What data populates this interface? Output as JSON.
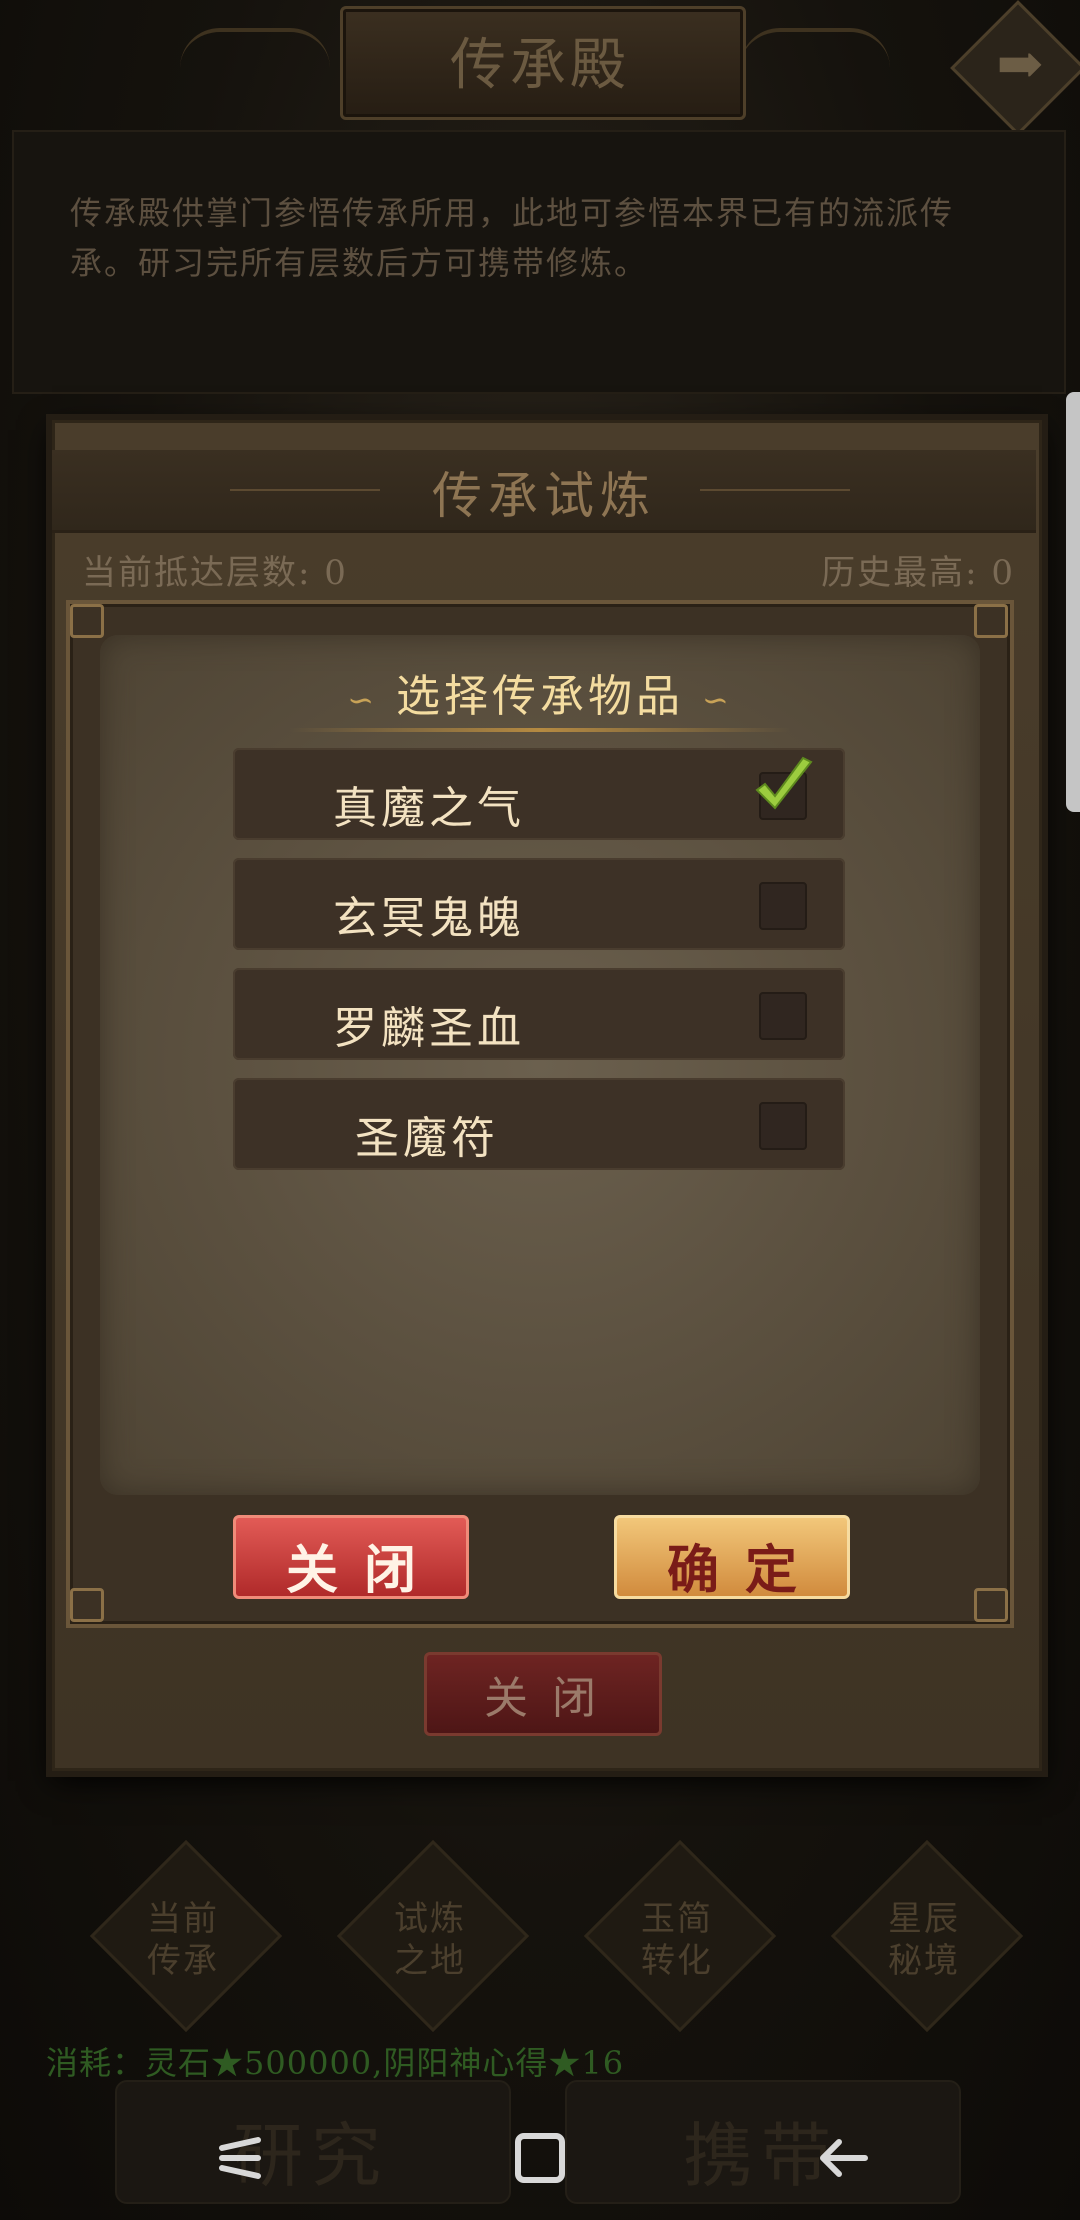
{
  "header": {
    "title": "传承殿",
    "description": "传承殿供掌门参悟传承所用，此地可参悟本界已有的流派传承。研习完所有层数后方可携带修炼。",
    "arrow_glyph": "➡"
  },
  "trial": {
    "title": "传承试炼",
    "current_floor_label": "当前抵达层数: 0",
    "history_high_label": "历史最高: 0",
    "close_label": "关闭"
  },
  "modal": {
    "title": "选择传承物品",
    "title_ornament_left": "∽",
    "title_ornament_right": "∽",
    "items": [
      {
        "label": "真魔之气",
        "checked": true
      },
      {
        "label": "玄冥鬼魄",
        "checked": false
      },
      {
        "label": "罗麟圣血",
        "checked": false
      },
      {
        "label": "圣魔符",
        "checked": false
      }
    ],
    "close_label": "关闭",
    "confirm_label": "确定"
  },
  "nav": {
    "items": [
      {
        "line1": "当前",
        "line2": "传承"
      },
      {
        "line1": "试炼",
        "line2": "之地"
      },
      {
        "line1": "玉简",
        "line2": "转化"
      },
      {
        "line1": "星辰",
        "line2": "秘境"
      }
    ]
  },
  "cost": {
    "text": "消耗：灵石★500000,阴阳神心得★16"
  },
  "actions": {
    "research_label": "研究",
    "carry_label": "携带"
  },
  "system_nav": {
    "recent_icon": "recent-apps-icon",
    "home_icon": "home-icon",
    "back_icon": "back-icon"
  },
  "colors": {
    "modal_title": "#f4dca0",
    "close_button": "#c83a36",
    "confirm_button": "#e3a75a",
    "check_green": "#8bc34a"
  }
}
